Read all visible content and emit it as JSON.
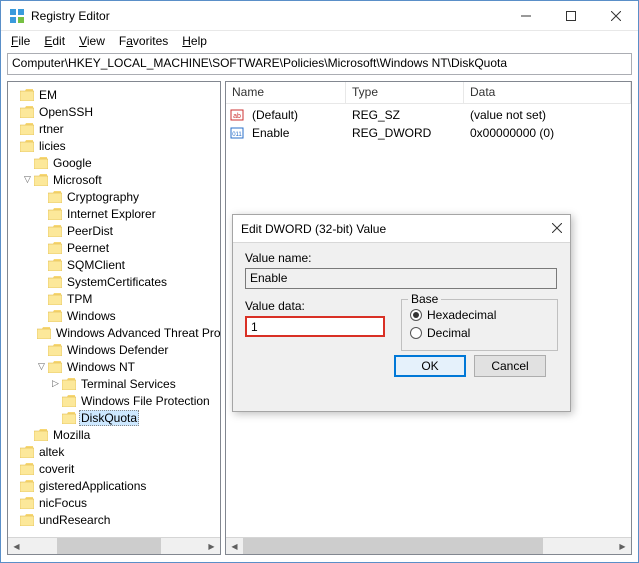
{
  "window": {
    "title": "Registry Editor"
  },
  "menu": {
    "file": "File",
    "edit": "Edit",
    "view": "View",
    "favorites": "Favorites",
    "help": "Help"
  },
  "path": "Computer\\HKEY_LOCAL_MACHINE\\SOFTWARE\\Policies\\Microsoft\\Windows NT\\DiskQuota",
  "tree": [
    {
      "indent": 0,
      "exp": "",
      "label": "EM"
    },
    {
      "indent": 0,
      "exp": "",
      "label": "OpenSSH"
    },
    {
      "indent": 0,
      "exp": "",
      "label": "rtner"
    },
    {
      "indent": 0,
      "exp": "",
      "label": "licies"
    },
    {
      "indent": 1,
      "exp": "",
      "label": "Google"
    },
    {
      "indent": 1,
      "exp": "-",
      "label": "Microsoft"
    },
    {
      "indent": 2,
      "exp": "",
      "label": "Cryptography"
    },
    {
      "indent": 2,
      "exp": "",
      "label": "Internet Explorer"
    },
    {
      "indent": 2,
      "exp": "",
      "label": "PeerDist"
    },
    {
      "indent": 2,
      "exp": "",
      "label": "Peernet"
    },
    {
      "indent": 2,
      "exp": "",
      "label": "SQMClient"
    },
    {
      "indent": 2,
      "exp": "",
      "label": "SystemCertificates"
    },
    {
      "indent": 2,
      "exp": "",
      "label": "TPM"
    },
    {
      "indent": 2,
      "exp": "",
      "label": "Windows"
    },
    {
      "indent": 2,
      "exp": "",
      "label": "Windows Advanced Threat Protec"
    },
    {
      "indent": 2,
      "exp": "",
      "label": "Windows Defender"
    },
    {
      "indent": 2,
      "exp": "-",
      "label": "Windows NT"
    },
    {
      "indent": 3,
      "exp": ">",
      "label": "Terminal Services"
    },
    {
      "indent": 3,
      "exp": "",
      "label": "Windows File Protection"
    },
    {
      "indent": 3,
      "exp": "",
      "label": "DiskQuota",
      "selected": true
    },
    {
      "indent": 1,
      "exp": "",
      "label": "Mozilla"
    },
    {
      "indent": 0,
      "exp": "",
      "label": "altek"
    },
    {
      "indent": 0,
      "exp": "",
      "label": "coverit"
    },
    {
      "indent": 0,
      "exp": "",
      "label": "gisteredApplications"
    },
    {
      "indent": 0,
      "exp": "",
      "label": "nicFocus"
    },
    {
      "indent": 0,
      "exp": "",
      "label": "undResearch"
    }
  ],
  "list": {
    "cols": {
      "name": "Name",
      "type": "Type",
      "data": "Data"
    },
    "rows": [
      {
        "icon": "sz",
        "name": "(Default)",
        "type": "REG_SZ",
        "data": "(value not set)"
      },
      {
        "icon": "dw",
        "name": "Enable",
        "type": "REG_DWORD",
        "data": "0x00000000 (0)"
      }
    ]
  },
  "dialog": {
    "title": "Edit DWORD (32-bit) Value",
    "value_name_label": "Value name:",
    "value_name": "Enable",
    "value_data_label": "Value data:",
    "value_data": "1",
    "base_label": "Base",
    "hex": "Hexadecimal",
    "dec": "Decimal",
    "ok": "OK",
    "cancel": "Cancel"
  }
}
